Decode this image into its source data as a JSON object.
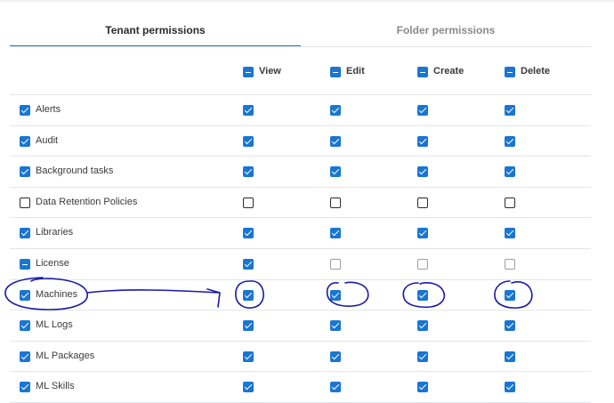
{
  "tabs": [
    {
      "label": "Tenant permissions",
      "active": true
    },
    {
      "label": "Folder permissions",
      "active": false
    }
  ],
  "columns": [
    {
      "label": "View",
      "state": "indeterminate"
    },
    {
      "label": "Edit",
      "state": "indeterminate"
    },
    {
      "label": "Create",
      "state": "indeterminate"
    },
    {
      "label": "Delete",
      "state": "indeterminate"
    }
  ],
  "rows": [
    {
      "label": "Alerts",
      "state": "checked",
      "cells": [
        "checked",
        "checked",
        "checked",
        "checked"
      ]
    },
    {
      "label": "Audit",
      "state": "checked",
      "cells": [
        "checked",
        "checked",
        "checked",
        "checked"
      ]
    },
    {
      "label": "Background tasks",
      "state": "checked",
      "cells": [
        "checked",
        "checked",
        "checked",
        "checked"
      ]
    },
    {
      "label": "Data Retention Policies",
      "state": "unchecked",
      "cells": [
        "unchecked",
        "unchecked",
        "unchecked",
        "unchecked"
      ]
    },
    {
      "label": "Libraries",
      "state": "checked",
      "cells": [
        "checked",
        "checked",
        "checked",
        "checked"
      ]
    },
    {
      "label": "License",
      "state": "indeterminate",
      "cells": [
        "checked",
        "disabled",
        "disabled",
        "disabled"
      ]
    },
    {
      "label": "Machines",
      "state": "checked",
      "cells": [
        "checked",
        "checked",
        "checked",
        "checked"
      ]
    },
    {
      "label": "ML Logs",
      "state": "checked",
      "cells": [
        "checked",
        "checked",
        "checked",
        "checked"
      ]
    },
    {
      "label": "ML Packages",
      "state": "checked",
      "cells": [
        "checked",
        "checked",
        "checked",
        "checked"
      ]
    },
    {
      "label": "ML Skills",
      "state": "checked",
      "cells": [
        "checked",
        "checked",
        "checked",
        "checked"
      ]
    }
  ],
  "colors": {
    "accent": "#1976d2",
    "annotation_ink": "#1a1aa8"
  }
}
